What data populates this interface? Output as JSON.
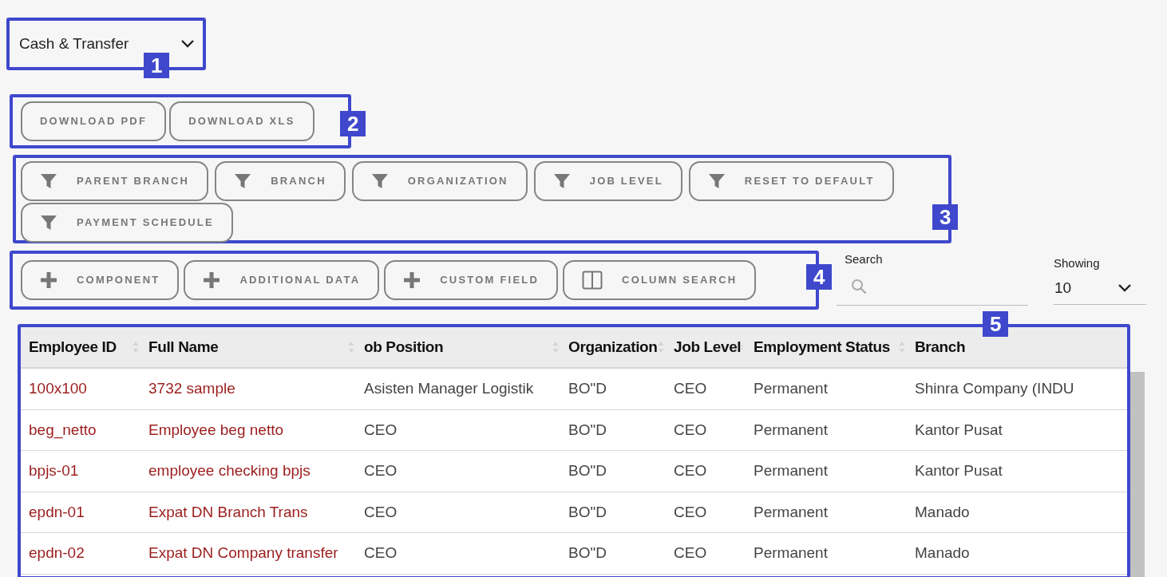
{
  "type_selector": {
    "annotation": "1",
    "value": "Cash & Transfer"
  },
  "download_buttons": {
    "annotation": "2",
    "items": [
      {
        "label": "DOWNLOAD PDF"
      },
      {
        "label": "DOWNLOAD XLS"
      }
    ]
  },
  "filter_buttons": {
    "annotation": "3",
    "items": [
      {
        "label": "PARENT BRANCH",
        "kind": "filter"
      },
      {
        "label": "BRANCH",
        "kind": "filter"
      },
      {
        "label": "ORGANIZATION",
        "kind": "filter"
      },
      {
        "label": "JOB LEVEL",
        "kind": "filter"
      },
      {
        "label": "RESET TO DEFAULT",
        "kind": "filter"
      },
      {
        "label": "PAYMENT SCHEDULE",
        "kind": "filter"
      }
    ]
  },
  "action_buttons": {
    "annotation": "4",
    "items": [
      {
        "label": "COMPONENT",
        "kind": "plus"
      },
      {
        "label": "ADDITIONAL DATA",
        "kind": "plus"
      },
      {
        "label": "CUSTOM FIELD",
        "kind": "plus"
      },
      {
        "label": "COLUMN SEARCH",
        "kind": "columns"
      }
    ]
  },
  "search": {
    "label": "Search"
  },
  "showing": {
    "label": "Showing",
    "value": "10"
  },
  "table": {
    "annotation": "5",
    "columns": [
      {
        "label": "Employee ID",
        "sortable": true
      },
      {
        "label": "Full Name",
        "sortable": true
      },
      {
        "label": "ob Position",
        "sortable": true
      },
      {
        "label": "Organization",
        "sortable": true
      },
      {
        "label": "Job Level",
        "sortable": true
      },
      {
        "label": "Employment Status",
        "sortable": true
      },
      {
        "label": "Branch",
        "sortable": false
      }
    ],
    "rows": [
      [
        "100x100",
        "3732 sample",
        "Asisten Manager Logistik",
        "BO\"D",
        "CEO",
        "Permanent",
        "Shinra Company (INDU"
      ],
      [
        "beg_netto",
        "Employee beg netto",
        "CEO",
        "BO\"D",
        "CEO",
        "Permanent",
        "Kantor Pusat"
      ],
      [
        "bpjs-01",
        "employee checking bpjs",
        "CEO",
        "BO\"D",
        "CEO",
        "Permanent",
        "Kantor Pusat"
      ],
      [
        "epdn-01",
        "Expat DN Branch Trans",
        "CEO",
        "BO\"D",
        "CEO",
        "Permanent",
        "Manado"
      ],
      [
        "epdn-02",
        "Expat DN Company transfer",
        "CEO",
        "BO\"D",
        "CEO",
        "Permanent",
        "Manado"
      ]
    ]
  }
}
